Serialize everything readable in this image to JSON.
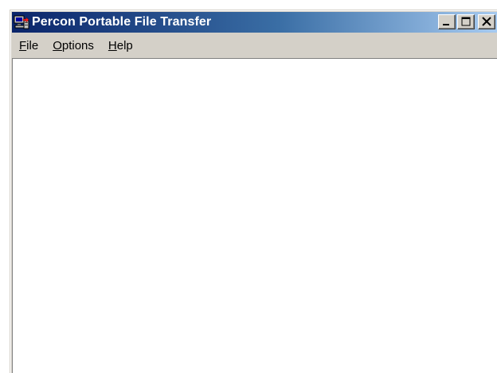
{
  "window": {
    "title": "Percon Portable File Transfer",
    "app_icon": "computer-transfer-icon",
    "caption_buttons": [
      {
        "name": "minimize",
        "icon": "minimize-icon"
      },
      {
        "name": "maximize",
        "icon": "maximize-icon"
      },
      {
        "name": "close",
        "icon": "close-icon"
      }
    ]
  },
  "menu": {
    "file": {
      "accel": "F",
      "rest": "ile"
    },
    "options": {
      "accel": "O",
      "rest": "ptions"
    },
    "help": {
      "accel": "H",
      "rest": "elp"
    }
  },
  "colors": {
    "titlebar_start": "#0a246a",
    "titlebar_end": "#a6caf0",
    "chrome": "#d4d0c8",
    "client": "#ffffff"
  }
}
